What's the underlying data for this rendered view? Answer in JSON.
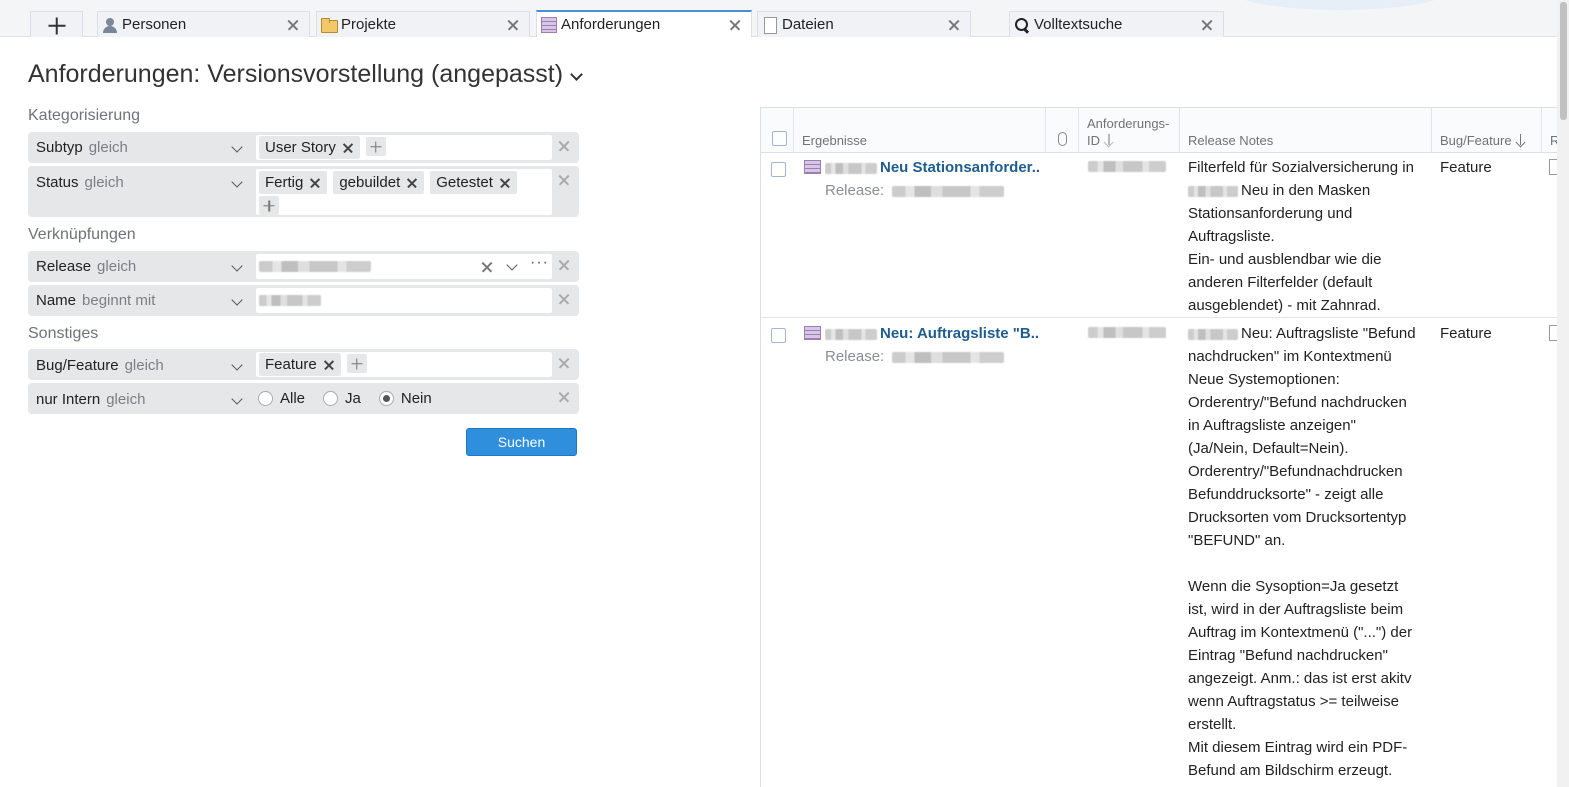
{
  "tabs": [
    {
      "label": "Personen",
      "icon": "person-icon",
      "active": false
    },
    {
      "label": "Projekte",
      "icon": "folder-icon",
      "active": false
    },
    {
      "label": "Anforderungen",
      "icon": "requirements-icon",
      "active": true
    },
    {
      "label": "Dateien",
      "icon": "document-icon",
      "active": false
    },
    {
      "label": "Volltextsuche",
      "icon": "search-icon",
      "active": false
    }
  ],
  "page": {
    "title": "Anforderungen: Versionsvorstellung (angepasst)"
  },
  "filters": {
    "sections": {
      "categorization": "Kategorisierung",
      "links": "Verknüpfungen",
      "other": "Sonstiges"
    },
    "subtyp": {
      "name": "Subtyp",
      "op": "gleich",
      "chips": [
        "User Story"
      ]
    },
    "status": {
      "name": "Status",
      "op": "gleich",
      "chips": [
        "Fertig",
        "gebuildet",
        "Getestet"
      ]
    },
    "release": {
      "name": "Release",
      "op": "gleich"
    },
    "name": {
      "name": "Name",
      "op": "beginnt mit"
    },
    "bugfeature": {
      "name": "Bug/Feature",
      "op": "gleich",
      "chips": [
        "Feature"
      ]
    },
    "intern": {
      "name": "nur Intern",
      "op": "gleich",
      "options": [
        "Alle",
        "Ja",
        "Nein"
      ],
      "selected": "Nein"
    },
    "search_label": "Suchen"
  },
  "grid": {
    "columns": {
      "results": "Ergebnisse",
      "req_id_line1": "Anforderungs-",
      "req_id_line2": "ID",
      "release_notes": "Release Notes",
      "bug_feature": "Bug/Feature",
      "extra": "R"
    },
    "rows": [
      {
        "title": "Neu Stationsanforder...",
        "release_label": "Release:",
        "notes": [
          "Filterfeld für Sozialversicherung in",
          "Neu in den Masken",
          "Stationsanforderung und",
          "Auftragsliste.",
          "Ein- und ausblendbar wie die",
          "anderen Filterfelder (default",
          "ausgeblendet) - mit Zahnrad."
        ],
        "type": "Feature"
      },
      {
        "title": "Neu: Auftragsliste \"B...",
        "release_label": "Release:",
        "notes": [
          "Neu: Auftragsliste \"Befund",
          "nachdrucken\" im Kontextmenü",
          "Neue Systemoptionen:",
          "Orderentry/\"Befund nachdrucken",
          "in Auftragsliste anzeigen\"",
          "(Ja/Nein, Default=Nein).",
          "Orderentry/\"Befundnachdrucken",
          "Befunddrucksorte\" - zeigt alle",
          "Drucksorten vom Drucksortentyp",
          "\"BEFUND\" an.",
          "",
          "Wenn die Sysoption=Ja gesetzt",
          "ist, wird in der Auftragsliste beim",
          "Auftrag im Kontextmenü (\"...\") der",
          "Eintrag \"Befund nachdrucken\"",
          "angezeigt. Anm.: das ist erst akitv",
          "wenn Auftragstatus >= teilweise",
          "erstellt.",
          "Mit diesem Eintrag wird ein PDF-",
          "Befund am Bildschirm erzeugt."
        ],
        "type": "Feature"
      }
    ]
  },
  "colors": {
    "accent": "#2f8fdc",
    "link": "#1e5d8f",
    "active_tab_border": "#4a90d9"
  }
}
